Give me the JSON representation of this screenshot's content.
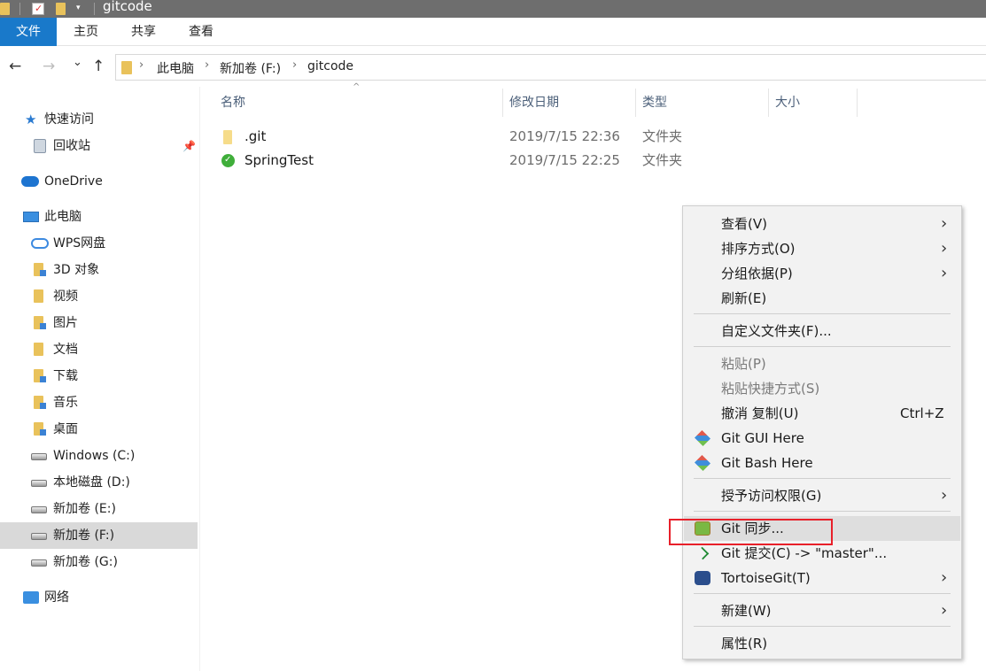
{
  "window": {
    "title": "gitcode"
  },
  "ribbon": {
    "tabs": [
      "文件",
      "主页",
      "共享",
      "查看"
    ]
  },
  "address": {
    "back": "←",
    "forward": "→",
    "recent": "⌄",
    "up": "↑",
    "crumbs": [
      "此电脑",
      "新加卷 (F:)",
      "gitcode"
    ]
  },
  "sidebar": {
    "quick_access": "快速访问",
    "recycle": "回收站",
    "onedrive": "OneDrive",
    "this_pc": "此电脑",
    "items": [
      "WPS网盘",
      "3D 对象",
      "视频",
      "图片",
      "文档",
      "下载",
      "音乐",
      "桌面",
      "Windows (C:)",
      "本地磁盘 (D:)",
      "新加卷 (E:)",
      "新加卷 (F:)",
      "新加卷 (G:)"
    ],
    "network": "网络"
  },
  "columns": {
    "name": "名称",
    "modified": "修改日期",
    "type": "类型",
    "size": "大小"
  },
  "files": [
    {
      "name": ".git",
      "modified": "2019/7/15 22:36",
      "type": "文件夹"
    },
    {
      "name": "SpringTest",
      "modified": "2019/7/15 22:25",
      "type": "文件夹"
    }
  ],
  "context_menu": {
    "view": "查看(V)",
    "sort": "排序方式(O)",
    "group": "分组依据(P)",
    "refresh": "刷新(E)",
    "customize": "自定义文件夹(F)...",
    "paste": "粘贴(P)",
    "paste_shortcut": "粘贴快捷方式(S)",
    "undo": "撤消 复制(U)",
    "undo_shortcut": "Ctrl+Z",
    "git_gui": "Git GUI Here",
    "git_bash": "Git Bash Here",
    "grant_access": "授予访问权限(G)",
    "git_sync": "Git 同步...",
    "git_commit": "Git 提交(C) -> \"master\"...",
    "tortoisegit": "TortoiseGit(T)",
    "new": "新建(W)",
    "properties": "属性(R)",
    "arrow": "›"
  },
  "colors": {
    "accent": "#1979ca",
    "highlight_box": "#e8202a"
  }
}
